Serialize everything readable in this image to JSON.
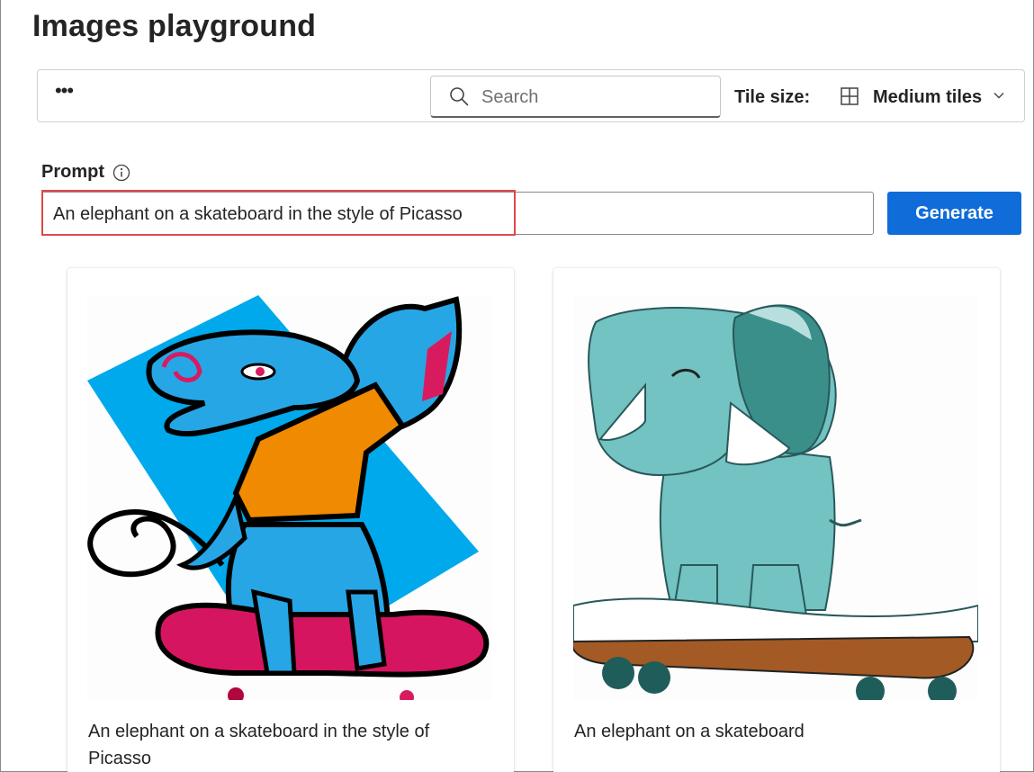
{
  "page": {
    "title": "Images playground"
  },
  "toolbar": {
    "more_label": "•••",
    "search": {
      "placeholder": "Search",
      "value": ""
    },
    "tile_size_label": "Tile size:",
    "tile_size_value": "Medium tiles"
  },
  "prompt": {
    "label": "Prompt",
    "value": "An elephant on a skateboard in the style of Picasso",
    "generate_label": "Generate"
  },
  "cards": [
    {
      "caption": "An elephant on a skateboard in the style of Picasso",
      "image": "elephant-picasso-illustration"
    },
    {
      "caption": "An elephant on a skateboard",
      "image": "elephant-skateboard-illustration"
    }
  ],
  "colors": {
    "accent": "#0f6cd8",
    "highlight": "#e0484b"
  }
}
